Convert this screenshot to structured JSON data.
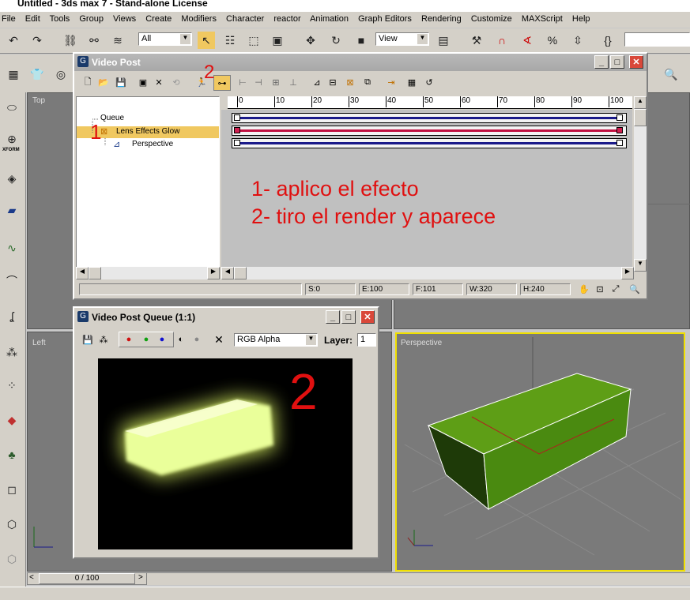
{
  "app": {
    "title": "Untitled - 3ds max 7  - Stand-alone License"
  },
  "menu": [
    "File",
    "Edit",
    "Tools",
    "Group",
    "Views",
    "Create",
    "Modifiers",
    "Character",
    "reactor",
    "Animation",
    "Graph Editors",
    "Rendering",
    "Customize",
    "MAXScript",
    "Help"
  ],
  "toolbar": {
    "selection_filter": "All",
    "ref_coord": "View"
  },
  "viewports": {
    "top": "Top",
    "left": "Left",
    "perspective": "Perspective"
  },
  "command_panel": {
    "xform_label": "XFORM"
  },
  "time_slider": {
    "value": "0 / 100"
  },
  "video_post": {
    "title": "Video Post",
    "queue_root": "Queue",
    "items": [
      {
        "label": "Lens Effects Glow",
        "selected": true
      },
      {
        "label": "Perspective",
        "selected": false
      }
    ],
    "ruler": [
      "0",
      "10",
      "20",
      "30",
      "40",
      "50",
      "60",
      "70",
      "80",
      "90",
      "100"
    ],
    "status": {
      "s": "S:0",
      "e": "E:100",
      "f": "F:101",
      "w": "W:320",
      "h": "H:240"
    }
  },
  "queue_window": {
    "title": "Video Post Queue (1:1)",
    "channel": "RGB Alpha",
    "layer_label": "Layer:",
    "layer_value": "1"
  },
  "annotations": {
    "marker1": "1",
    "marker2_toolbar": "2",
    "line1": "1- aplico el efecto",
    "line2": "2- tiro el render y aparece",
    "marker2_big": "2"
  },
  "colors": {
    "annotation": "#e01010",
    "selected_row": "#f0c860",
    "viewport_bg": "#7a7a7a",
    "box_green": "#4a8a10",
    "glow": "#f4ffa0",
    "active_border": "#f0e000"
  }
}
